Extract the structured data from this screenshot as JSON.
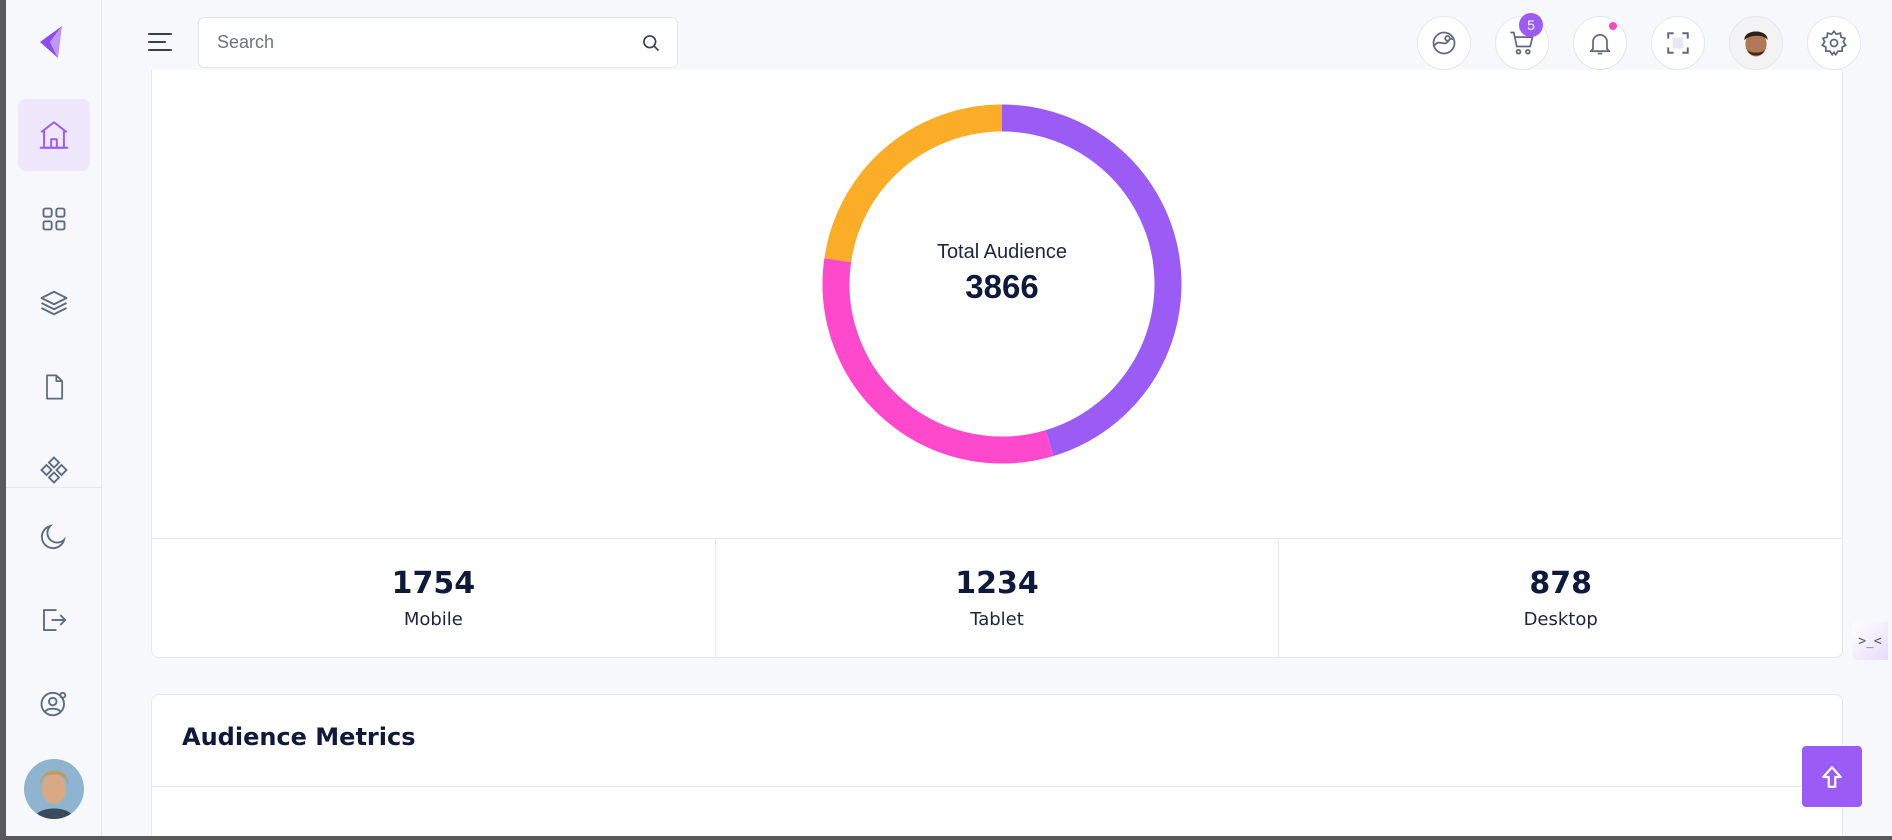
{
  "app": {
    "accent_color": "#9b5cf6",
    "logo_icon": "logo-icon"
  },
  "sidebar": {
    "items": [
      {
        "name": "home-icon",
        "active": true
      },
      {
        "name": "grid-icon",
        "active": false
      },
      {
        "name": "layers-icon",
        "active": false
      },
      {
        "name": "file-icon",
        "active": false
      },
      {
        "name": "components-icon",
        "active": false
      },
      {
        "name": "moon-icon",
        "active": false
      },
      {
        "name": "logout-icon",
        "active": false
      },
      {
        "name": "user-settings-icon",
        "active": false
      }
    ]
  },
  "header": {
    "search_placeholder": "Search",
    "cart_count": "5",
    "icons": [
      "theme-icon",
      "cart-icon",
      "bell-icon",
      "fullscreen-icon",
      "avatar",
      "gear-icon"
    ]
  },
  "audience": {
    "center_label": "Total Audience",
    "center_total": "3866",
    "stats": [
      {
        "value": "1754",
        "label": "Mobile"
      },
      {
        "value": "1234",
        "label": "Tablet"
      },
      {
        "value": "878",
        "label": "Desktop"
      }
    ]
  },
  "chart_data": {
    "type": "pie",
    "donut": true,
    "categories": [
      "Mobile",
      "Tablet",
      "Desktop"
    ],
    "values": [
      1754,
      1234,
      878
    ],
    "colors": [
      "#9b5cf6",
      "#ff49cd",
      "#fcad28"
    ],
    "title": "",
    "center_text": "Total Audience",
    "center_value": 3866
  },
  "metrics": {
    "title": "Audience Metrics"
  },
  "floating": {
    "code_toggle": ">_<",
    "scroll_top_icon": "arrow-up-icon"
  }
}
